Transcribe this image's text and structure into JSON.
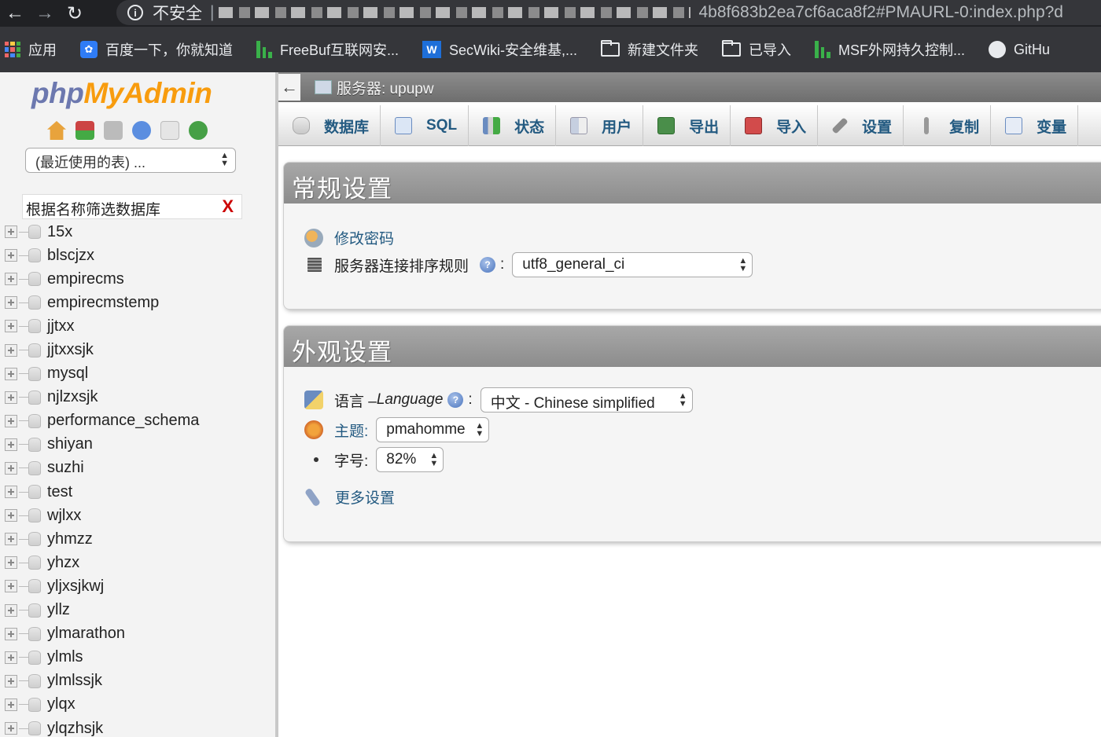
{
  "browser": {
    "security_label": "不安全",
    "url_visible": "4b8f683b2ea7cf6aca8f2#PMAURL-0:index.php?d",
    "bookmarks": [
      {
        "label": "应用",
        "icon": "apps-icon"
      },
      {
        "label": "百度一下，你就知道",
        "icon": "baidu-icon"
      },
      {
        "label": "FreeBuf互联网安...",
        "icon": "freebuf-icon"
      },
      {
        "label": "SecWiki-安全维基,...",
        "icon": "secwiki-icon"
      },
      {
        "label": "新建文件夹",
        "icon": "folder-icon"
      },
      {
        "label": "已导入",
        "icon": "folder-icon"
      },
      {
        "label": "MSF外网持久控制...",
        "icon": "freebuf-icon"
      },
      {
        "label": "GitHu",
        "icon": "github-icon"
      }
    ]
  },
  "sidebar": {
    "logo_php": "php",
    "logo_myadmin": "MyAdmin",
    "recent_tables": "(最近使用的表) ...",
    "filter_placeholder": "根据名称筛选数据库",
    "filter_clear": "X",
    "databases": [
      "15x",
      "blscjzx",
      "empirecms",
      "empirecmstemp",
      "jjtxx",
      "jjtxxsjk",
      "mysql",
      "njlzxsjk",
      "performance_schema",
      "shiyan",
      "suzhi",
      "test",
      "wjlxx",
      "yhmzz",
      "yhzx",
      "yljxsjkwj",
      "yllz",
      "ylmarathon",
      "ylmls",
      "ylmlssjk",
      "ylqx",
      "ylqzhsjk"
    ]
  },
  "main": {
    "back_arrow": "←",
    "server_label": "服务器: upupw",
    "tabs": [
      {
        "label": "数据库",
        "icon": "database-icon"
      },
      {
        "label": "SQL",
        "icon": "sql-icon"
      },
      {
        "label": "状态",
        "icon": "status-icon"
      },
      {
        "label": "用户",
        "icon": "users-icon"
      },
      {
        "label": "导出",
        "icon": "export-icon"
      },
      {
        "label": "导入",
        "icon": "import-icon"
      },
      {
        "label": "设置",
        "icon": "settings-icon"
      },
      {
        "label": "复制",
        "icon": "replication-icon"
      },
      {
        "label": "变量",
        "icon": "variables-icon"
      }
    ],
    "general": {
      "title": "常规设置",
      "change_password": "修改密码",
      "collation_label": "服务器连接排序规则",
      "collation_value": "utf8_general_ci"
    },
    "appearance": {
      "title": "外观设置",
      "language_label_cn": "语言 – ",
      "language_label_en": "Language",
      "language_value": "中文 - Chinese simplified",
      "theme_label": "主题:",
      "theme_value": "pmahomme",
      "font_size_label": "字号:",
      "font_size_value": "82%",
      "more_settings": "更多设置"
    }
  },
  "colors": {
    "link": "#235a81",
    "logo_php": "#6c78af",
    "logo_myadmin": "#f89c0e",
    "panel_header": "#999999",
    "filter_clear": "#cc0000"
  }
}
